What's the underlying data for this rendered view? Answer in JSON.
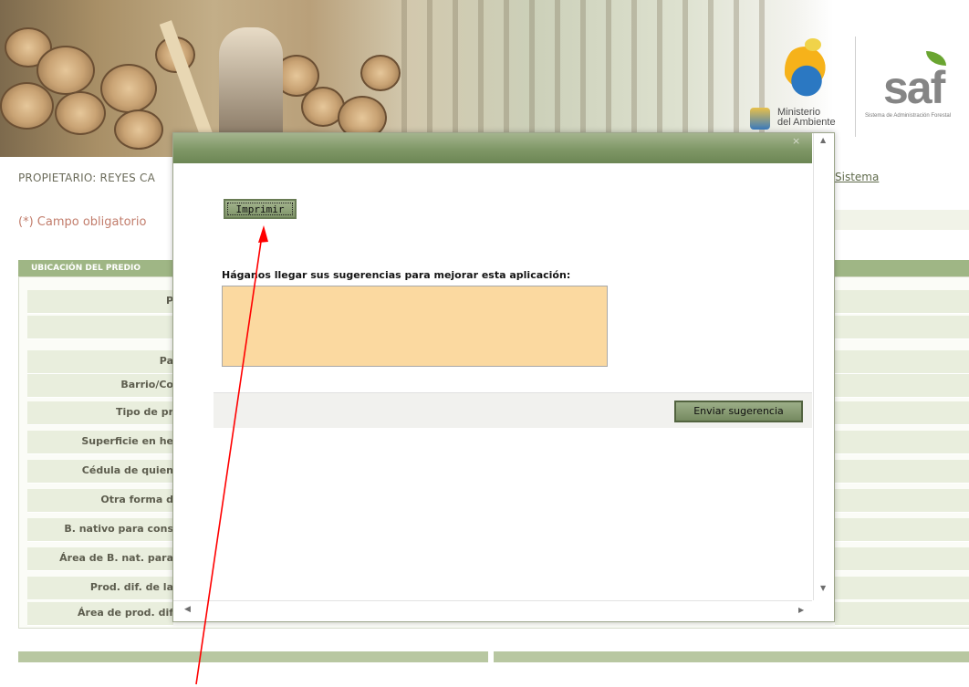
{
  "header": {
    "ministerio_line1": "Ministerio",
    "ministerio_line2": "del Ambiente",
    "saf_logo_text": "saf",
    "saf_subtitle": "Sistema de Administración Forestal"
  },
  "page": {
    "owner_label": "PROPIETARIO: REYES CA",
    "system_link": "Sistema",
    "required_note": "(*) Campo obligatorio",
    "section_title": "UBICACIÓN DEL PREDIO",
    "form_labels": [
      "P",
      "",
      "Pa",
      "Barrio/Co",
      "Tipo de pr",
      "Superficie en he",
      "Cédula de quien",
      "Otra forma d",
      "B. nativo para cons",
      "Área de B. nat. para",
      "Prod. dif. de la",
      "Área de prod. dif"
    ]
  },
  "modal": {
    "close_symbol": "×",
    "print_button": "Imprimir",
    "suggestion_label": "Háganos llegar sus sugerencias para mejorar esta aplicación:",
    "suggestion_value": "",
    "send_button": "Enviar sugerencia",
    "scroll_up": "▲",
    "scroll_down": "▼",
    "scroll_left": "◀",
    "scroll_right": "▶"
  },
  "colors": {
    "titlebar": "#7f9766",
    "textarea_bg": "#fbd9a0",
    "annotation_arrow": "#ff0000"
  }
}
